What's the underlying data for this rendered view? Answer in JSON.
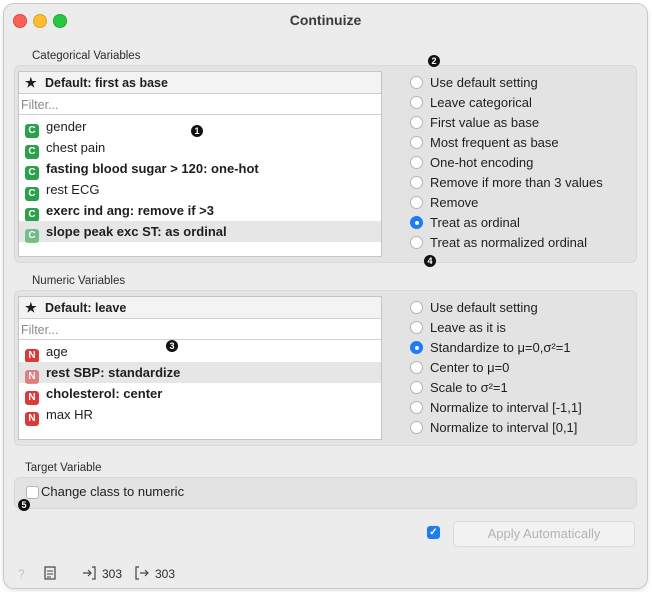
{
  "window": {
    "title": "Continuize"
  },
  "categorical": {
    "section_label": "Categorical Variables",
    "default_label": "Default: first as base",
    "filter_placeholder": "Filter...",
    "items": [
      {
        "badge": "C",
        "label": "gender",
        "bold": false,
        "selected": false
      },
      {
        "badge": "C",
        "label": "chest pain",
        "bold": false,
        "selected": false
      },
      {
        "badge": "C",
        "label": "fasting blood sugar > 120: one-hot",
        "bold": true,
        "selected": false
      },
      {
        "badge": "C",
        "label": "rest ECG",
        "bold": false,
        "selected": false
      },
      {
        "badge": "C",
        "label": "exerc ind ang: remove if >3",
        "bold": true,
        "selected": false
      },
      {
        "badge": "C",
        "label": "slope peak exc ST: as ordinal",
        "bold": true,
        "selected": true
      }
    ],
    "options": [
      {
        "label": "Use default setting",
        "checked": false
      },
      {
        "label": "Leave categorical",
        "checked": false
      },
      {
        "label": "First value as base",
        "checked": false
      },
      {
        "label": "Most frequent as base",
        "checked": false
      },
      {
        "label": "One-hot encoding",
        "checked": false
      },
      {
        "label": "Remove if more than 3 values",
        "checked": false
      },
      {
        "label": "Remove",
        "checked": false
      },
      {
        "label": "Treat as ordinal",
        "checked": true
      },
      {
        "label": "Treat as normalized ordinal",
        "checked": false
      }
    ]
  },
  "numeric": {
    "section_label": "Numeric Variables",
    "default_label": "Default: leave",
    "filter_placeholder": "Filter...",
    "items": [
      {
        "badge": "N",
        "label": "age",
        "bold": false,
        "selected": false
      },
      {
        "badge": "N",
        "label": "rest SBP: standardize",
        "bold": true,
        "selected": true
      },
      {
        "badge": "N",
        "label": "cholesterol: center",
        "bold": true,
        "selected": false
      },
      {
        "badge": "N",
        "label": "max HR",
        "bold": false,
        "selected": false
      }
    ],
    "options": [
      {
        "label": "Use default setting",
        "checked": false
      },
      {
        "label": "Leave as it is",
        "checked": false
      },
      {
        "label": "Standardize to μ=0,σ²=1",
        "checked": true
      },
      {
        "label": "Center to μ=0",
        "checked": false
      },
      {
        "label": "Scale to σ²=1",
        "checked": false
      },
      {
        "label": "Normalize to interval [-1,1]",
        "checked": false
      },
      {
        "label": "Normalize to interval [0,1]",
        "checked": false
      }
    ]
  },
  "target": {
    "section_label": "Target Variable",
    "checkbox_label": "Change class to numeric",
    "checked": false
  },
  "apply": {
    "label": "Apply Automatically",
    "auto_checked": true
  },
  "status": {
    "input_count": "303",
    "output_count": "303"
  },
  "callouts": [
    "1",
    "2",
    "3",
    "4",
    "5"
  ]
}
